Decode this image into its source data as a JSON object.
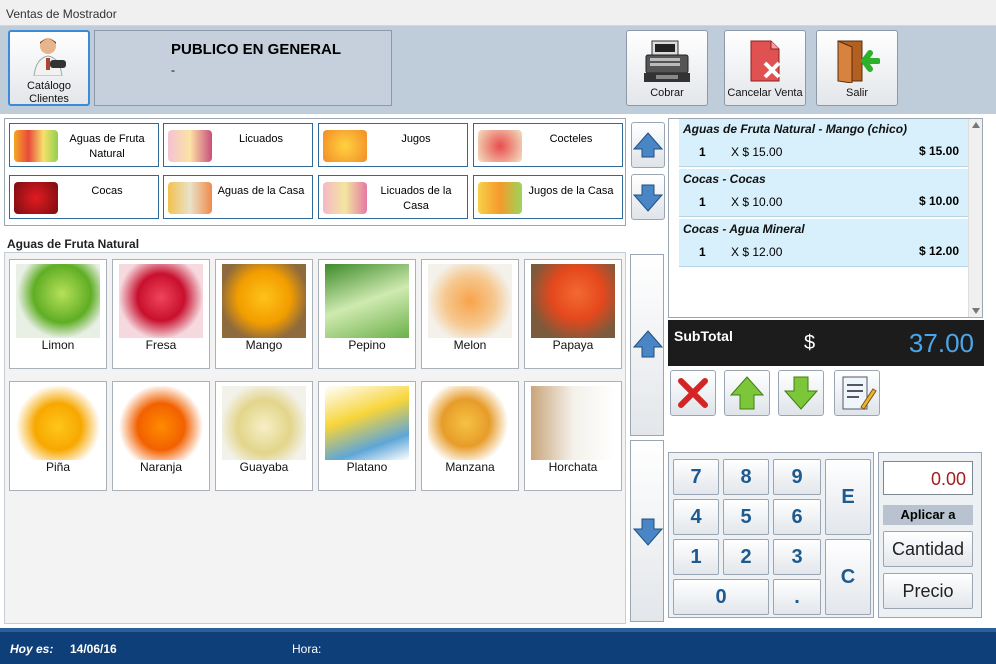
{
  "window": {
    "title": "Ventas de Mostrador"
  },
  "client": {
    "button_label": "Catálogo Clientes",
    "name": "PUBLICO EN GENERAL",
    "detail": "-"
  },
  "toolbar": {
    "cobrar": "Cobrar",
    "cancelar": "Cancelar Venta",
    "salir": "Salir"
  },
  "categories": [
    {
      "label": "Aguas de Fruta Natural"
    },
    {
      "label": "Licuados"
    },
    {
      "label": "Jugos"
    },
    {
      "label": "Cocteles"
    },
    {
      "label": "Cocas"
    },
    {
      "label": "Aguas de la Casa"
    },
    {
      "label": "Licuados de la Casa"
    },
    {
      "label": "Jugos de la Casa"
    }
  ],
  "section_title": "Aguas de Fruta Natural",
  "products": [
    {
      "name": "Limon"
    },
    {
      "name": "Fresa"
    },
    {
      "name": "Mango"
    },
    {
      "name": "Pepino"
    },
    {
      "name": "Melon"
    },
    {
      "name": "Papaya"
    },
    {
      "name": "Piña"
    },
    {
      "name": "Naranja"
    },
    {
      "name": "Guayaba"
    },
    {
      "name": "Platano"
    },
    {
      "name": "Manzana"
    },
    {
      "name": "Horchata"
    }
  ],
  "order": [
    {
      "name": "Aguas de Fruta Natural - Mango (chico)",
      "qty": "1",
      "unit": "X $ 15.00",
      "total": "$ 15.00"
    },
    {
      "name": "Cocas - Cocas",
      "qty": "1",
      "unit": "X $ 10.00",
      "total": "$ 10.00"
    },
    {
      "name": "Cocas - Agua Mineral",
      "qty": "1",
      "unit": "X $ 12.00",
      "total": "$ 12.00"
    }
  ],
  "subtotal": {
    "label": "SubTotal",
    "currency": "$",
    "value": "37.00"
  },
  "keypad": {
    "k7": "7",
    "k8": "8",
    "k9": "9",
    "k4": "4",
    "k5": "5",
    "k6": "6",
    "k1": "1",
    "k2": "2",
    "k3": "3",
    "k0": "0",
    "dot": ".",
    "e": "E",
    "c": "C"
  },
  "input": {
    "amount": "0.00",
    "apply_label": "Aplicar a",
    "cantidad": "Cantidad",
    "precio": "Precio"
  },
  "footer": {
    "date_label": "Hoy es:",
    "date": "14/06/16",
    "time_label": "Hora:"
  }
}
